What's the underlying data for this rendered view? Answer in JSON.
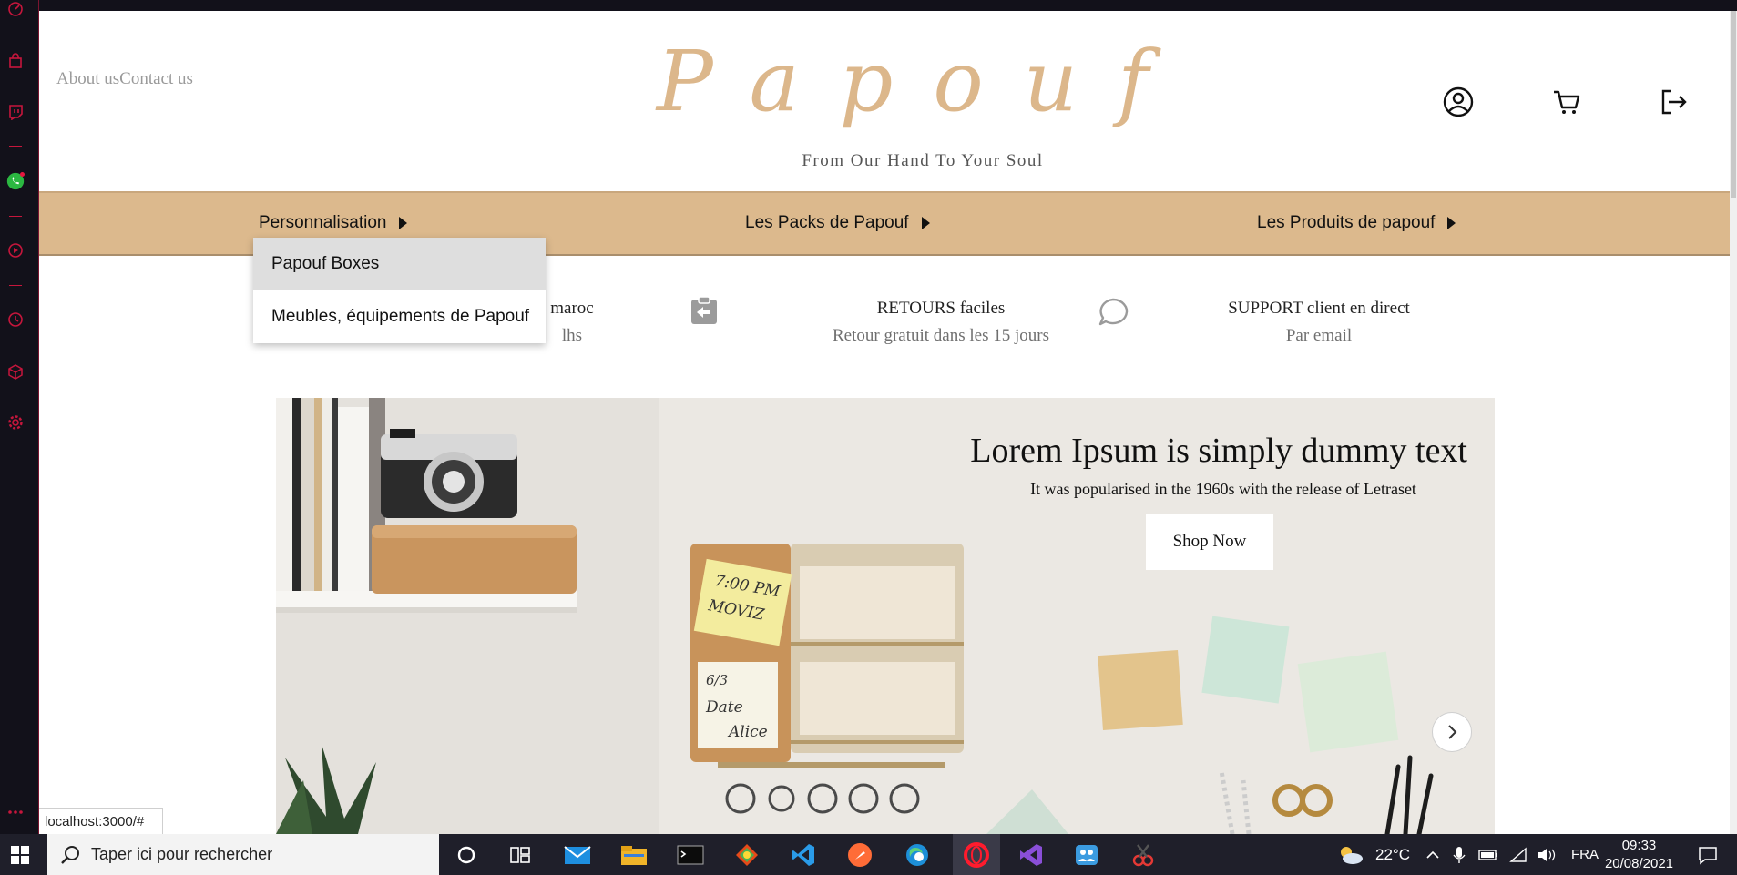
{
  "browser": {
    "status_url": "localhost:3000/#"
  },
  "header": {
    "about_link": "About us",
    "contact_link": "Contact us",
    "logo_text": "Papouf",
    "tagline": "From Our Hand To Your Soul",
    "icons": [
      "user-circle-icon",
      "cart-icon",
      "logout-icon"
    ]
  },
  "navbar": {
    "items": [
      {
        "label": "Personnalisation"
      },
      {
        "label": "Les Packs de Papouf"
      },
      {
        "label": "Les Produits de papouf"
      }
    ]
  },
  "dropdown": {
    "items": [
      {
        "label": "Papouf Boxes",
        "active": true
      },
      {
        "label": "Meubles, équipements de Papouf",
        "active": false
      }
    ]
  },
  "features": [
    {
      "title": "maroc",
      "subtitle": "lhs",
      "icon": "truck-icon"
    },
    {
      "title": "RETOURS faciles",
      "subtitle": "Retour gratuit dans les 15 jours",
      "icon": "return-clipboard-icon"
    },
    {
      "title": "SUPPORT client en direct",
      "subtitle": "Par email",
      "icon": "chat-bubble-icon"
    }
  ],
  "hero": {
    "title": "Lorem Ipsum is simply dummy text",
    "subtitle": "It was popularised in the 1960s with the release of Letraset",
    "button_label": "Shop Now",
    "note_1_line1": "7:00 PM",
    "note_1_line2": "MOVIZ",
    "note_2_line1": "6/3",
    "note_2_line2": "Date",
    "note_2_line3": "Alice"
  },
  "taskbar": {
    "search_placeholder": "Taper ici pour rechercher",
    "weather": "22°C",
    "language": "FRA",
    "time": "09:33",
    "date": "20/08/2021"
  },
  "colors": {
    "brand_gold": "#dcb78b",
    "navbar_bg": "#dcb98d",
    "sidebar_accent": "#c6163c"
  }
}
